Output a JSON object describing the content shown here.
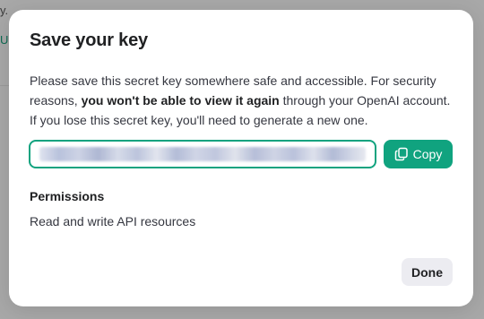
{
  "background": {
    "top_text": "y.",
    "link_text": "U"
  },
  "modal": {
    "title": "Save your key",
    "description": {
      "part1": "Please save this secret key somewhere safe and accessible. For security reasons, ",
      "bold": "you won't be able to view it again",
      "part2": " through your OpenAI account. If you lose this secret key, you'll need to generate a new one."
    },
    "key_field": {
      "value": "",
      "obscured": true
    },
    "copy_button": {
      "label": "Copy",
      "icon": "copy-icon"
    },
    "permissions": {
      "heading": "Permissions",
      "value": "Read and write API resources"
    },
    "done_button": {
      "label": "Done"
    }
  },
  "colors": {
    "accent": "#10a37f",
    "overlay": "#a8a8a8",
    "secondary_button": "#ececf1",
    "text_primary": "#202123"
  }
}
